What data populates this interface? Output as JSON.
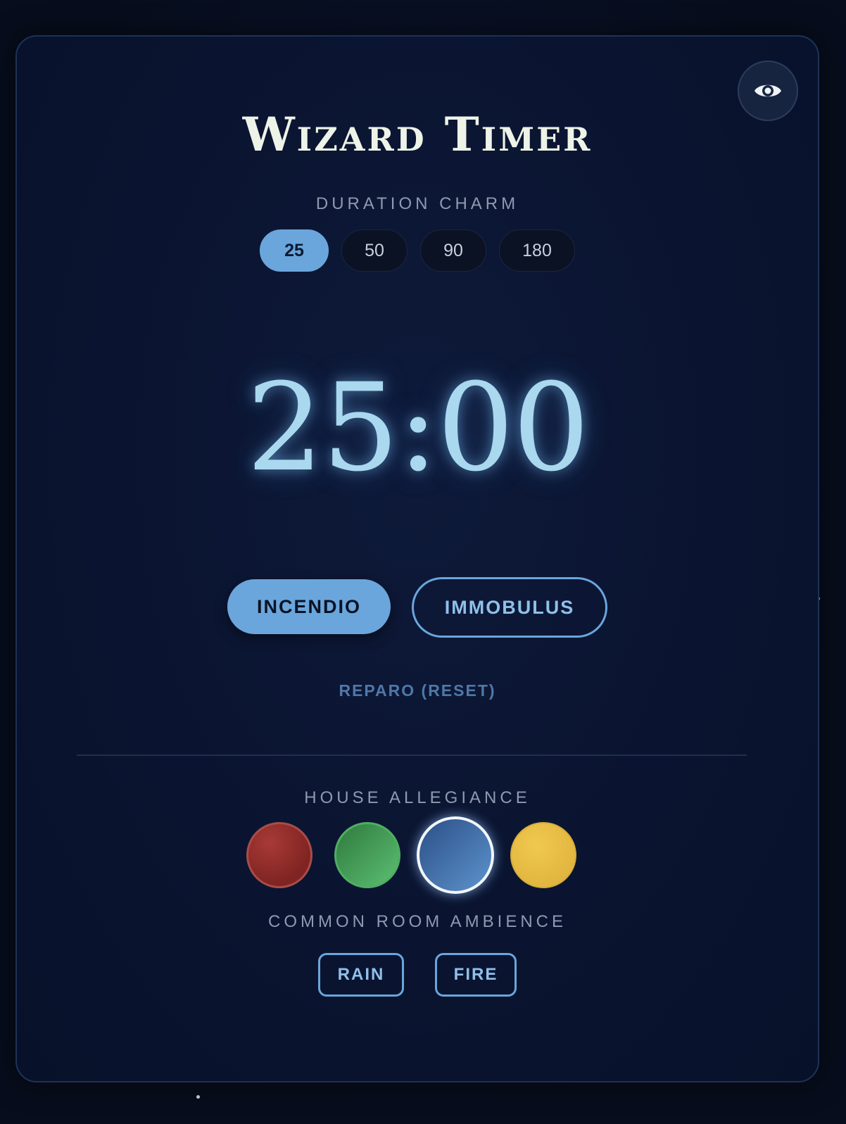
{
  "app": {
    "title": "Wizard Timer"
  },
  "duration": {
    "label": "DURATION CHARM",
    "options": [
      "25",
      "50",
      "90",
      "180"
    ],
    "selected": "25"
  },
  "timer": {
    "display": "25:00"
  },
  "controls": {
    "start_label": "INCENDIO",
    "pause_label": "IMMOBULUS",
    "reset_label": "REPARO (RESET)"
  },
  "house": {
    "label": "HOUSE ALLEGIANCE",
    "options": [
      {
        "color": "#8a2a28"
      },
      {
        "color": "#3f9450"
      },
      {
        "color": "#3c6ea8",
        "selected": true
      },
      {
        "color": "#e8bf48"
      }
    ]
  },
  "ambience": {
    "label": "COMMON ROOM AMBIENCE",
    "options": [
      "RAIN",
      "FIRE"
    ]
  },
  "colors": {
    "accent": "#6aa6dc",
    "timer": "#a9d8ef",
    "background": "#0a1430"
  },
  "icons": {
    "toggle": "eye-icon"
  }
}
